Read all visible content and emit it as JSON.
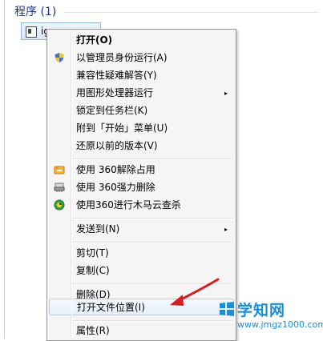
{
  "section": {
    "title": "程序 (1)"
  },
  "result": {
    "label": "ig"
  },
  "menu": {
    "items": [
      {
        "label": "打开(O)",
        "bold": true
      },
      {
        "label": "以管理员身份运行(A)",
        "icon": "uac-shield-icon"
      },
      {
        "label": "兼容性疑难解答(Y)"
      },
      {
        "label": "用图形处理器运行",
        "submenu": "▸"
      },
      {
        "label": "锁定到任务栏(K)"
      },
      {
        "label": "附到「开始」菜单(U)"
      },
      {
        "label": "还原以前的版本(V)"
      },
      {
        "label": "使用 360解除占用",
        "icon": "360-unlock-icon"
      },
      {
        "label": "使用 360强力删除",
        "icon": "360-shred-icon"
      },
      {
        "label": "使用360进行木马云查杀",
        "icon": "360-scan-icon"
      },
      {
        "label": "发送到(N)",
        "submenu": "▸"
      },
      {
        "label": "剪切(T)"
      },
      {
        "label": "复制(C)"
      },
      {
        "label": "删除(D)"
      },
      {
        "label": "打开文件位置(I)"
      },
      {
        "label": "属性(R)"
      }
    ]
  },
  "watermark": {
    "title": "学知网",
    "url": "www.jmgz1000.com"
  },
  "colors": {
    "accent": "#1e3287",
    "watermark": "#1a8fd6",
    "arrow": "#d42020"
  }
}
